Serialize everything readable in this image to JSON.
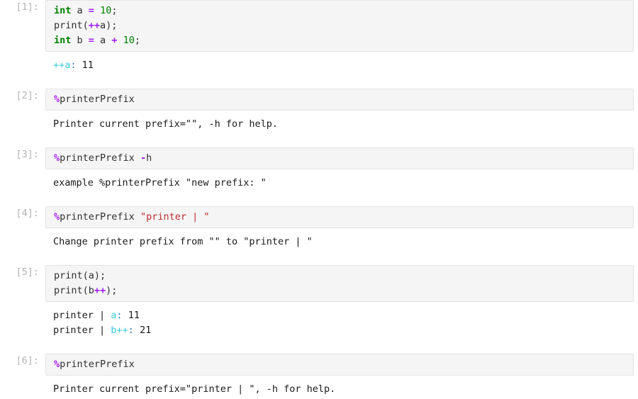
{
  "notebook": {
    "cells": [
      {
        "prompt": "[1]:",
        "input_lines": [
          [
            {
              "t": "int",
              "c": "tok-kw"
            },
            {
              "t": " a ",
              "c": "tok-plain"
            },
            {
              "t": "=",
              "c": "tok-op"
            },
            {
              "t": " ",
              "c": "tok-plain"
            },
            {
              "t": "10",
              "c": "tok-num"
            },
            {
              "t": ";",
              "c": "tok-plain"
            }
          ],
          [
            {
              "t": "print(",
              "c": "tok-fn"
            },
            {
              "t": "++",
              "c": "tok-op"
            },
            {
              "t": "a);",
              "c": "tok-plain"
            }
          ],
          [
            {
              "t": "int",
              "c": "tok-kw"
            },
            {
              "t": " b ",
              "c": "tok-plain"
            },
            {
              "t": "=",
              "c": "tok-op"
            },
            {
              "t": " a ",
              "c": "tok-plain"
            },
            {
              "t": "+",
              "c": "tok-op"
            },
            {
              "t": " ",
              "c": "tok-plain"
            },
            {
              "t": "10",
              "c": "tok-num"
            },
            {
              "t": ";",
              "c": "tok-plain"
            }
          ]
        ],
        "output_lines": [
          [
            {
              "t": "++a",
              "c": "o-name"
            },
            {
              "t": ":",
              "c": "o-colon"
            },
            {
              "t": " 11",
              "c": "o-val"
            }
          ]
        ]
      },
      {
        "prompt": "[2]:",
        "input_lines": [
          [
            {
              "t": "%",
              "c": "tok-magic"
            },
            {
              "t": "printerPrefix",
              "c": "tok-magicname"
            }
          ]
        ],
        "output_lines": [
          [
            {
              "t": "Printer current prefix=\"\", -h for help.",
              "c": "o-plain"
            }
          ]
        ]
      },
      {
        "prompt": "[3]:",
        "input_lines": [
          [
            {
              "t": "%",
              "c": "tok-magic"
            },
            {
              "t": "printerPrefix ",
              "c": "tok-magicname"
            },
            {
              "t": "-",
              "c": "tok-op"
            },
            {
              "t": "h",
              "c": "tok-plain"
            }
          ]
        ],
        "output_lines": [
          [
            {
              "t": "example %printerPrefix \"new prefix: \"",
              "c": "o-plain"
            }
          ]
        ]
      },
      {
        "prompt": "[4]:",
        "input_lines": [
          [
            {
              "t": "%",
              "c": "tok-magic"
            },
            {
              "t": "printerPrefix ",
              "c": "tok-magicname"
            },
            {
              "t": "\"printer | \"",
              "c": "tok-str"
            }
          ]
        ],
        "output_lines": [
          [
            {
              "t": "Change printer prefix from \"\" to \"printer | \"",
              "c": "o-plain"
            }
          ]
        ]
      },
      {
        "prompt": "[5]:",
        "input_lines": [
          [
            {
              "t": "print(a);",
              "c": "tok-plain"
            }
          ],
          [
            {
              "t": "print(b",
              "c": "tok-plain"
            },
            {
              "t": "++",
              "c": "tok-op"
            },
            {
              "t": ");",
              "c": "tok-plain"
            }
          ]
        ],
        "output_lines": [
          [
            {
              "t": "printer | ",
              "c": "o-plain"
            },
            {
              "t": "a",
              "c": "o-name"
            },
            {
              "t": ":",
              "c": "o-colon"
            },
            {
              "t": " 11",
              "c": "o-val"
            }
          ],
          [
            {
              "t": "printer | ",
              "c": "o-plain"
            },
            {
              "t": "b++",
              "c": "o-name"
            },
            {
              "t": ":",
              "c": "o-colon"
            },
            {
              "t": " 21",
              "c": "o-val"
            }
          ]
        ]
      },
      {
        "prompt": "[6]:",
        "input_lines": [
          [
            {
              "t": "%",
              "c": "tok-magic"
            },
            {
              "t": "printerPrefix",
              "c": "tok-magicname"
            }
          ]
        ],
        "output_lines": [
          [
            {
              "t": "Printer current prefix=\"printer | \", -h for help.",
              "c": "o-plain"
            }
          ]
        ]
      }
    ]
  },
  "theme": {
    "input_background": "#f5f5f5",
    "input_border": "#e3e3e3",
    "page_background": "#ffffff",
    "prompt_color": "#b3b3b3",
    "keyword_color": "#008000",
    "number_color": "#008000",
    "operator_color": "#a020f0",
    "magic_color": "#aa22ff",
    "string_color": "#bd2c2c",
    "output_name_color": "#3bc9db",
    "output_text_color": "#1a1a1a"
  }
}
